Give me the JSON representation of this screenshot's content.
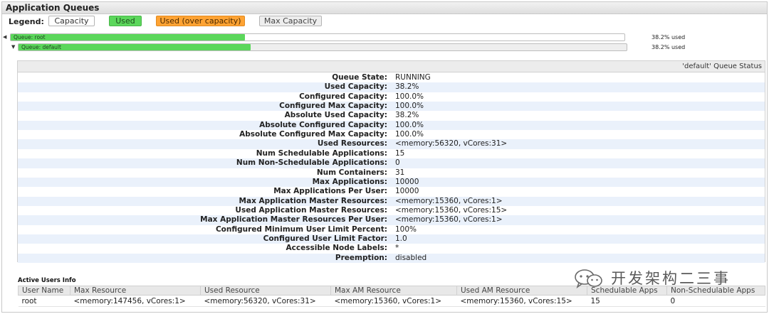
{
  "panel": {
    "title": "Application Queues"
  },
  "legend": {
    "label": "Legend:",
    "items": [
      {
        "label": "Capacity",
        "color": "#ffffff"
      },
      {
        "label": "Used",
        "color": "#5bd75b"
      },
      {
        "label": "Used (over capacity)",
        "color": "#ffa333"
      },
      {
        "label": "Max Capacity",
        "color": "#eeeeee"
      }
    ]
  },
  "queues": [
    {
      "name": "Queue: root",
      "used_pct_text": "38.2% used",
      "used_fraction": 0.382
    },
    {
      "name": "Queue: default",
      "used_pct_text": "38.2% used",
      "used_fraction": 0.382
    }
  ],
  "queue_status": {
    "header": "'default' Queue Status",
    "rows": [
      {
        "label": "Queue State:",
        "value": "RUNNING"
      },
      {
        "label": "Used Capacity:",
        "value": "38.2%"
      },
      {
        "label": "Configured Capacity:",
        "value": "100.0%"
      },
      {
        "label": "Configured Max Capacity:",
        "value": "100.0%"
      },
      {
        "label": "Absolute Used Capacity:",
        "value": "38.2%"
      },
      {
        "label": "Absolute Configured Capacity:",
        "value": "100.0%"
      },
      {
        "label": "Absolute Configured Max Capacity:",
        "value": "100.0%"
      },
      {
        "label": "Used Resources:",
        "value": "<memory:56320, vCores:31>"
      },
      {
        "label": "Num Schedulable Applications:",
        "value": "15"
      },
      {
        "label": "Num Non-Schedulable Applications:",
        "value": "0"
      },
      {
        "label": "Num Containers:",
        "value": "31"
      },
      {
        "label": "Max Applications:",
        "value": "10000"
      },
      {
        "label": "Max Applications Per User:",
        "value": "10000"
      },
      {
        "label": "Max Application Master Resources:",
        "value": "<memory:15360, vCores:1>"
      },
      {
        "label": "Used Application Master Resources:",
        "value": "<memory:15360, vCores:15>"
      },
      {
        "label": "Max Application Master Resources Per User:",
        "value": "<memory:15360, vCores:1>"
      },
      {
        "label": "Configured Minimum User Limit Percent:",
        "value": "100%"
      },
      {
        "label": "Configured User Limit Factor:",
        "value": "1.0"
      },
      {
        "label": "Accessible Node Labels:",
        "value": "*"
      },
      {
        "label": "Preemption:",
        "value": "disabled"
      }
    ]
  },
  "active_users": {
    "title": "Active Users Info",
    "columns": [
      "User Name",
      "Max Resource",
      "Used Resource",
      "Max AM Resource",
      "Used AM Resource",
      "Schedulable Apps",
      "Non-Schedulable Apps"
    ],
    "rows": [
      [
        "root",
        "<memory:147456, vCores:1>",
        "<memory:56320, vCores:31>",
        "<memory:15360, vCores:1>",
        "<memory:15360, vCores:15>",
        "15",
        "0"
      ]
    ]
  },
  "watermark": {
    "text": "开发架构二三事",
    "icon": "wechat-icon"
  }
}
